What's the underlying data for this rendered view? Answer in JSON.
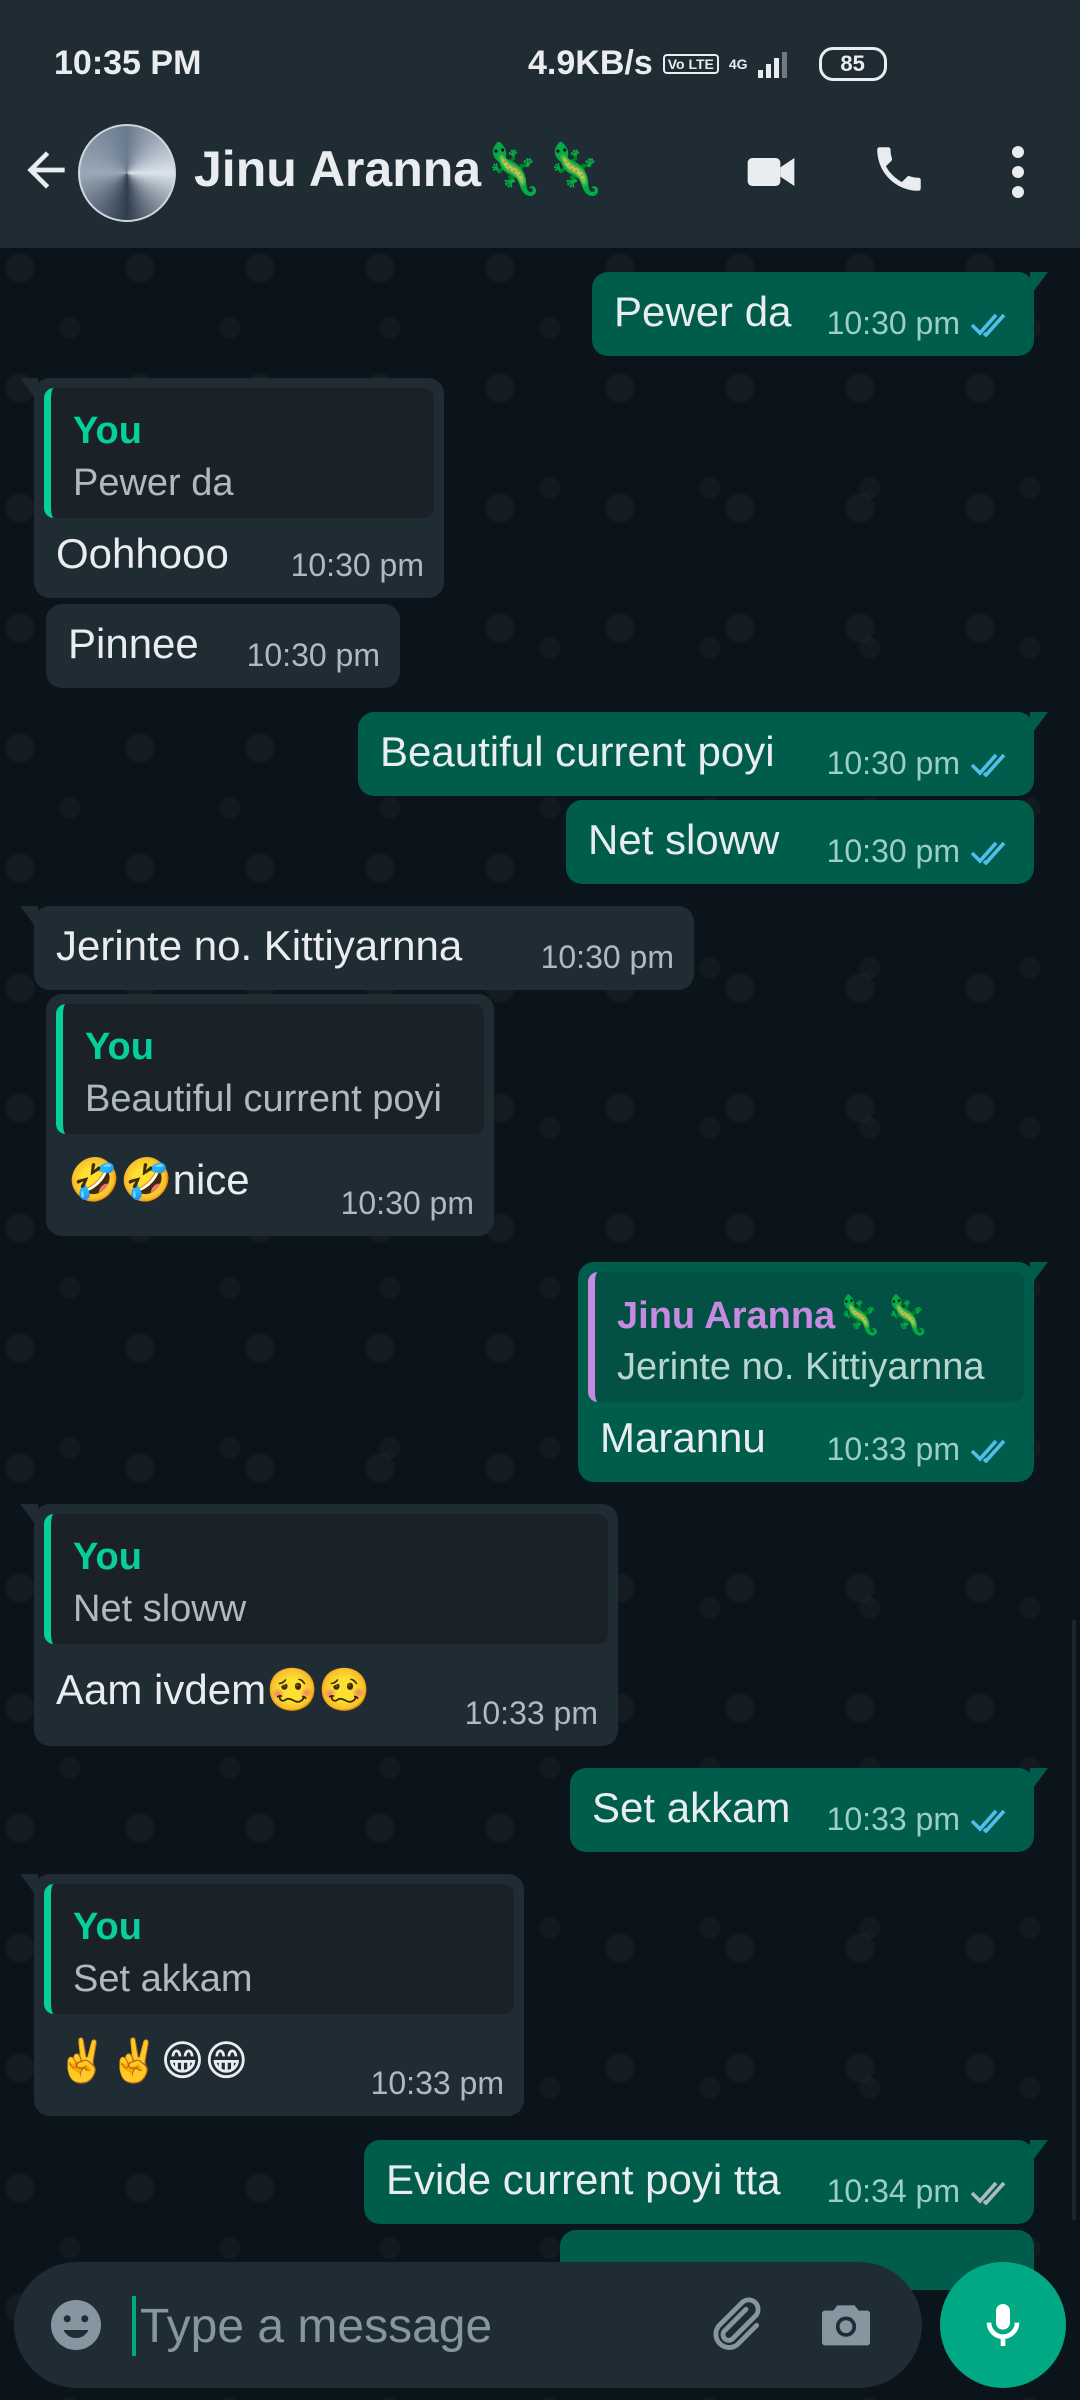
{
  "status_bar": {
    "time": "10:35 PM",
    "speed": "4.9KB/s",
    "volte": "Vo LTE",
    "network": "4G",
    "battery": "85"
  },
  "header": {
    "contact_name": "Jinu Aranna🦎🦎",
    "icons": [
      "back-arrow-icon",
      "video-call-icon",
      "phone-call-icon",
      "more-options-icon"
    ]
  },
  "messages": [
    {
      "dir": "out",
      "text": "Pewer da",
      "time": "10:30 pm",
      "status": "read"
    },
    {
      "dir": "in",
      "quote_author": "You",
      "quote_text": "Pewer da",
      "text": "Oohhooo",
      "time": "10:30 pm"
    },
    {
      "dir": "in",
      "text": "Pinnee",
      "time": "10:30 pm"
    },
    {
      "dir": "out",
      "text": "Beautiful current poyi",
      "time": "10:30 pm",
      "status": "read"
    },
    {
      "dir": "out",
      "text": "Net sloww",
      "time": "10:30 pm",
      "status": "read"
    },
    {
      "dir": "in",
      "text": "Jerinte no. Kittiyarnna",
      "time": "10:30 pm"
    },
    {
      "dir": "in",
      "quote_author": "You",
      "quote_text": "Beautiful current poyi",
      "text": "🤣🤣nice",
      "time": "10:30 pm"
    },
    {
      "dir": "out",
      "quote_author": "Jinu Aranna🦎🦎",
      "quote_text": "Jerinte no. Kittiyarnna",
      "text": "Marannu",
      "time": "10:33 pm",
      "status": "read"
    },
    {
      "dir": "in",
      "quote_author": "You",
      "quote_text": "Net sloww",
      "text": "Aam ivdem🥴🥴",
      "time": "10:33 pm"
    },
    {
      "dir": "out",
      "text": "Set akkam",
      "time": "10:33 pm",
      "status": "read"
    },
    {
      "dir": "in",
      "quote_author": "You",
      "quote_text": "Set akkam",
      "text": "✌️✌️😁😁",
      "time": "10:33 pm"
    },
    {
      "dir": "out",
      "text": "Evide current poyi tta",
      "time": "10:34 pm",
      "status": "delivered"
    }
  ],
  "input": {
    "placeholder": "Type a message"
  },
  "colors": {
    "background": "#0b141a",
    "header": "#1f2c33",
    "outgoing_bubble": "#005c4b",
    "incoming_bubble": "#202c33",
    "accent": "#00a884",
    "read_ticks": "#53bdeb",
    "delivered_ticks": "#aebac1"
  }
}
